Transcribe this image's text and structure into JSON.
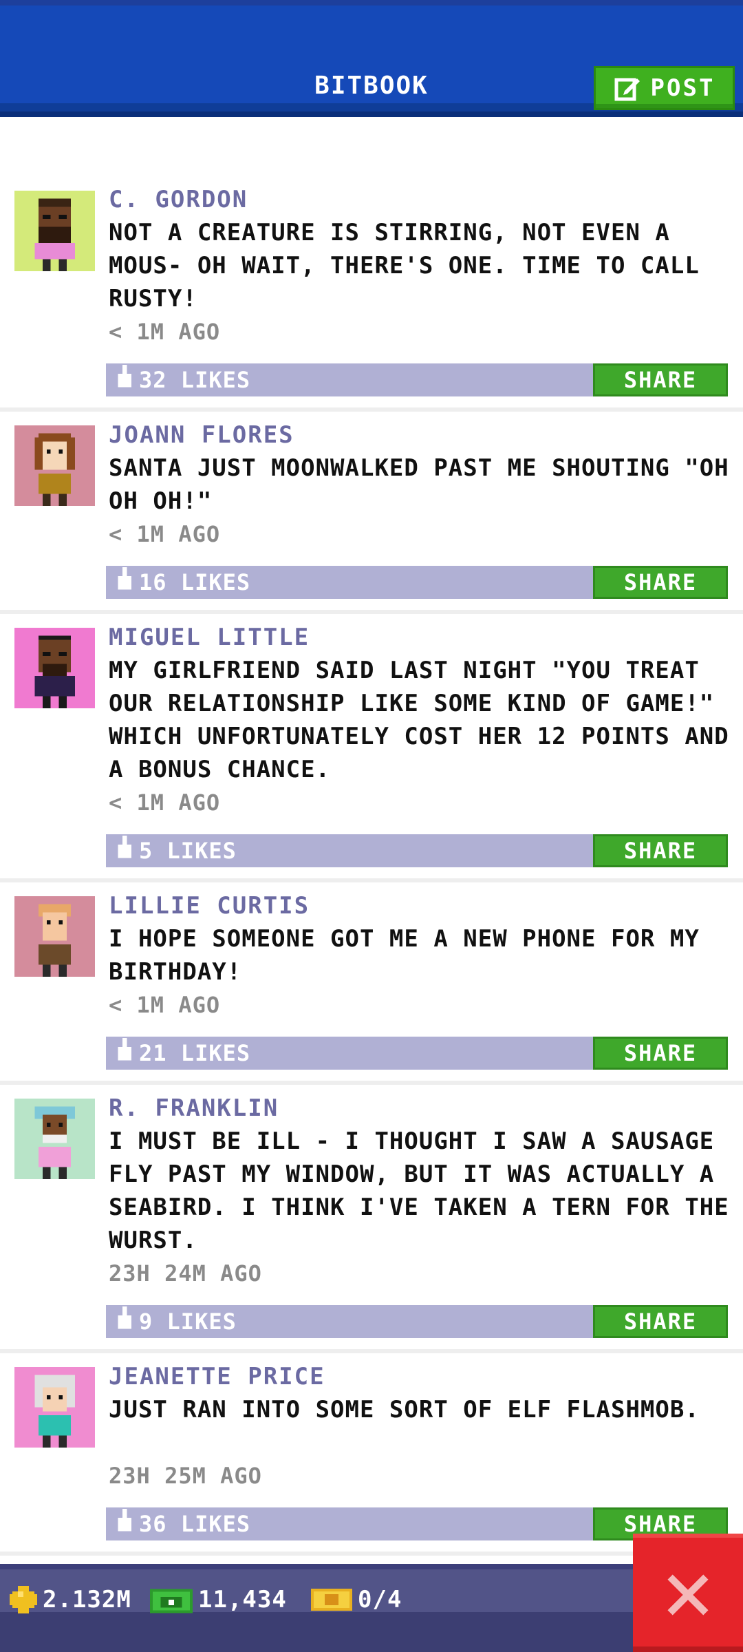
{
  "header": {
    "title": "BITBOOK",
    "post_label": "POST"
  },
  "posts": [
    {
      "name": "C. GORDON",
      "message": "NOT A CREATURE IS STIRRING, NOT EVEN A MOUS- OH WAIT, THERE'S ONE. TIME TO CALL RUSTY!",
      "time": "< 1M AGO",
      "likes": "32 LIKES",
      "share": "SHARE"
    },
    {
      "name": "JOANN FLORES",
      "message": "SANTA JUST MOONWALKED PAST ME SHOUTING \"OH OH OH!\"",
      "time": "< 1M AGO",
      "likes": "16 LIKES",
      "share": "SHARE"
    },
    {
      "name": "MIGUEL LITTLE",
      "message": "MY GIRLFRIEND SAID LAST NIGHT \"YOU TREAT OUR RELATIONSHIP LIKE SOME KIND OF GAME!\" WHICH UNFORTUNATELY COST HER 12 POINTS AND A BONUS CHANCE.",
      "time": "< 1M AGO",
      "likes": "5 LIKES",
      "share": "SHARE"
    },
    {
      "name": "LILLIE CURTIS",
      "message": "I HOPE SOMEONE GOT ME A NEW PHONE FOR MY BIRTHDAY!",
      "time": "< 1M AGO",
      "likes": "21 LIKES",
      "share": "SHARE"
    },
    {
      "name": "R. FRANKLIN",
      "message": "I MUST BE ILL - I THOUGHT I SAW A SAUSAGE FLY PAST MY WINDOW, BUT IT WAS ACTUALLY A SEABIRD. I THINK I'VE TAKEN A TERN FOR THE WURST.",
      "time": "23H 24M AGO",
      "likes": "9 LIKES",
      "share": "SHARE"
    },
    {
      "name": "JEANETTE PRICE",
      "message": "JUST RAN INTO SOME SORT OF ELF FLASHMOB.",
      "time": "23H 25M AGO",
      "likes": "36 LIKES",
      "share": "SHARE"
    }
  ],
  "status_bar": {
    "coins": "2.132M",
    "bux": "11,434",
    "tickets": "0/4"
  },
  "colors": {
    "header_blue": "#1549b8",
    "post_green": "#3fb01f",
    "name_purple": "#6b6aa2",
    "like_bar": "#b0b0d4",
    "close_red": "#e5242a"
  },
  "icons": {
    "post": "edit-icon",
    "likes": "thumbs-up-icon",
    "coins": "coin-icon",
    "bux": "bux-icon",
    "tickets": "ticket-icon",
    "close": "close-icon"
  }
}
